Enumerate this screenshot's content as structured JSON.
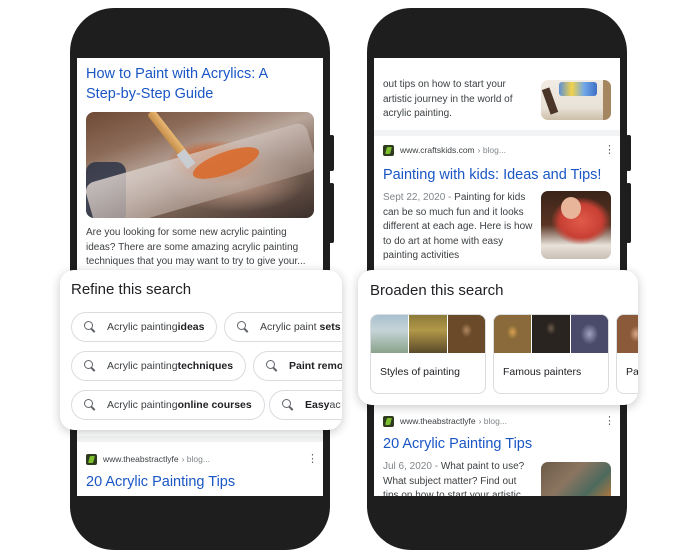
{
  "left_phone": {
    "top_result": {
      "title": "How to Paint with Acrylics: A Step-by-Step Guide",
      "image": "paintbrush-on-palette-image",
      "snippet": "Are you looking for some new acrylic painting ideas? There are some amazing acrylic painting techniques that you may want to try to give your..."
    },
    "refine_panel": {
      "title": "Refine this search",
      "chips": [
        {
          "prefix": "Acrylic painting ",
          "bold": "ideas",
          "icon": "search-icon"
        },
        {
          "prefix": "Acrylic paint ",
          "bold": "sets",
          "icon": "search-icon"
        },
        {
          "prefix": "Acrylic painting ",
          "bold": "techniques",
          "icon": "search-icon"
        },
        {
          "prefix": "",
          "bold": "Paint remo",
          "icon": "search-icon"
        },
        {
          "prefix": "Acrylic painting ",
          "bold": "online courses",
          "icon": "search-icon"
        },
        {
          "prefix": "",
          "bold": "Easy",
          "suffix": " ac",
          "icon": "search-icon"
        }
      ]
    },
    "bottom_result": {
      "site": "www.theabstractlyfe",
      "breadcrumb": "› blog...",
      "title": "20 Acrylic Painting Tips",
      "menu_icon": "more-vert-icon"
    }
  },
  "right_phone": {
    "top_snippet": {
      "text": "out tips on how to start your artistic journey in the world of acrylic painting.",
      "image": "person-painting-wall-image"
    },
    "kids_result": {
      "site": "www.craftskids.com",
      "breadcrumb": "› blog...",
      "title": "Painting with kids: Ideas and Tips!",
      "date": "Sept 22, 2020",
      "snippet": "Painting for kids can be so much fun and it looks different at each age. Here is how to do art at home with easy painting activities",
      "image": "child-painting-image",
      "menu_icon": "more-vert-icon"
    },
    "broaden_panel": {
      "title": "Broaden this search",
      "cards": [
        {
          "label": "Styles of painting",
          "images": [
            "monet-woman-with-parasol",
            "dali-persistence-of-memory",
            "mona-lisa"
          ]
        },
        {
          "label": "Famous painters",
          "images": [
            "van-gogh-self-portrait",
            "monet-portrait",
            "picasso-portrait"
          ]
        },
        {
          "label": "Pai",
          "images": [
            "portrait-painting"
          ]
        }
      ]
    },
    "bottom_result": {
      "site": "www.theabstractlyfe",
      "breadcrumb": "› blog...",
      "title": "20 Acrylic Painting Tips",
      "date": "Jul 6, 2020",
      "snippet": "What paint to use? What subject matter? Find out tips on how to start your artistic...",
      "image": "painting-supplies-image",
      "menu_icon": "more-vert-icon"
    }
  },
  "colors": {
    "link_blue": "#1a56c4",
    "phone_frame": "#1e1e1e",
    "chip_border": "#dadce0",
    "muted_text": "#80868b"
  }
}
